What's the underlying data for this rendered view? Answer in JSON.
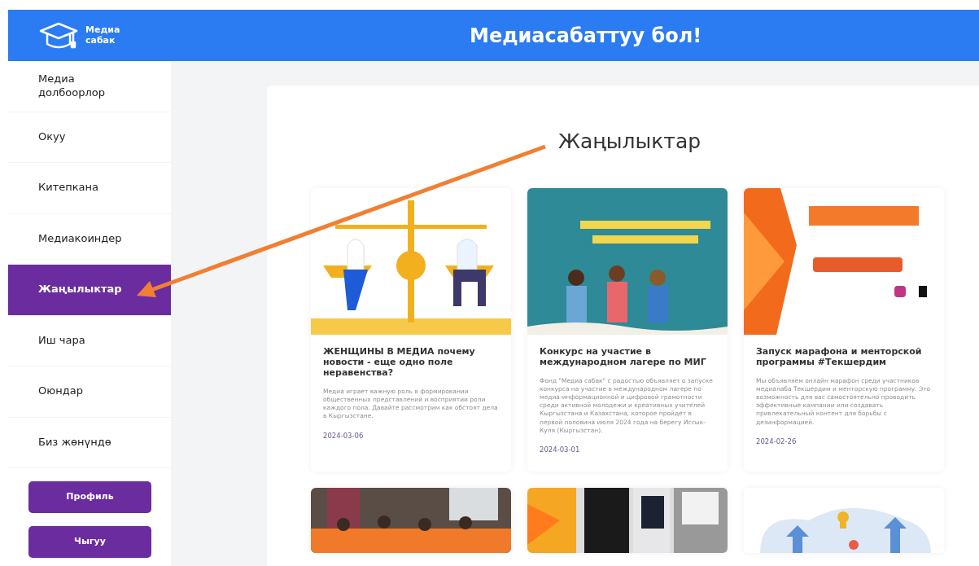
{
  "header": {
    "logo_text": "Медиа сабак",
    "title": "Медиасабаттуу бол!"
  },
  "sidebar": {
    "items": [
      {
        "label": "Медиа долбоорлор",
        "selected": false
      },
      {
        "label": "Окуу",
        "selected": false
      },
      {
        "label": "Китепкана",
        "selected": false
      },
      {
        "label": "Медиакоиндер",
        "selected": false
      },
      {
        "label": "Жаңылыктар",
        "selected": true
      },
      {
        "label": "Иш чара",
        "selected": false
      },
      {
        "label": "Оюндар",
        "selected": false
      },
      {
        "label": "Биз жөнүндө",
        "selected": false
      }
    ],
    "buttons": [
      "Профиль",
      "Чыгуу"
    ]
  },
  "main": {
    "title": "Жаңылыктар",
    "news": [
      {
        "title": "ЖЕНЩИНЫ В МЕДИА почему новости - еще одно поле неравенства?",
        "excerpt": "Медиа играет важную роль в формировании общественных представлений и восприятии роли каждого пола. Давайте рассмотрим как обстоят дела в Кыргызстане.",
        "date": "2024-03-06"
      },
      {
        "title": "Конкурс на участие в международном лагере по МИГ",
        "excerpt": "Фонд \"Медиа сабак\" с радостью объявляет о запуске конкурса на участие в международном лагере по медиа-информационной и цифровой грамотности среди активной молодежи и креативных учителей Кыргызстана и Казахстана, которое пройдет в первой половина июля 2024 года на берегу Иссык-Куля (Кыргызстан).",
        "date": "2024-03-01"
      },
      {
        "title": "Запуск марафона и менторской программы #Текшердим",
        "excerpt": "Мы объявляем онлайн марафон среди участников медиалаба Текшердим и менторскую программу.  Это возможность для вас самостоятельно проводить эффективные кампании или создавать привлекательный контент для борьбы с дезинформацией.",
        "date": "2024-02-26"
      },
      {
        "kind": "picture"
      },
      {
        "kind": "picture"
      },
      {
        "kind": "picture"
      }
    ]
  }
}
